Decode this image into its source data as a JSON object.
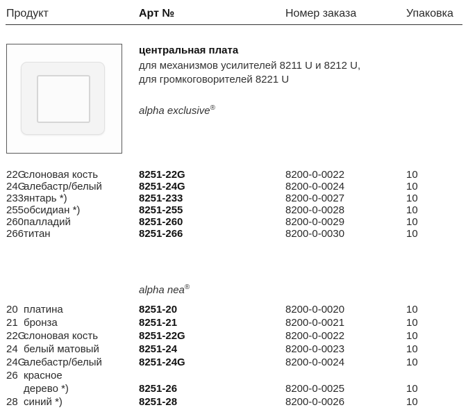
{
  "header": {
    "product": "Продукт",
    "article": "Арт №",
    "order_number": "Номер заказа",
    "packaging": "Упаковка"
  },
  "product": {
    "title": "центральная плата",
    "desc_line1": "для механизмов усилителей 8211 U и 8212 U,",
    "desc_line2": "для громкоговорителей 8221 U"
  },
  "sections": [
    {
      "line": "alpha exclusive",
      "reg": "®",
      "rows": [
        {
          "code": "22G",
          "name": "слоновая кость",
          "art": "8251-22G",
          "order": "8200-0-0022",
          "pack": "10"
        },
        {
          "code": "24G",
          "name": "алебастр/белый",
          "art": "8251-24G",
          "order": "8200-0-0024",
          "pack": "10"
        },
        {
          "code": "233",
          "name": "янтарь *)",
          "art": "8251-233",
          "order": "8200-0-0027",
          "pack": "10"
        },
        {
          "code": "255",
          "name": "обсидиан *)",
          "art": "8251-255",
          "order": "8200-0-0028",
          "pack": "10"
        },
        {
          "code": "260",
          "name": "палладий",
          "art": "8251-260",
          "order": "8200-0-0029",
          "pack": "10"
        },
        {
          "code": "266",
          "name": "титан",
          "art": "8251-266",
          "order": "8200-0-0030",
          "pack": "10"
        }
      ]
    },
    {
      "line": "alpha nea",
      "reg": "®",
      "rows": [
        {
          "code": "20",
          "name": "платина",
          "art": "8251-20",
          "order": "8200-0-0020",
          "pack": "10"
        },
        {
          "code": "21",
          "name": "бронза",
          "art": "8251-21",
          "order": "8200-0-0021",
          "pack": "10"
        },
        {
          "code": "22G",
          "name": "слоновая кость",
          "art": "8251-22G",
          "order": "8200-0-0022",
          "pack": "10"
        },
        {
          "code": "24",
          "name": "белый матовый",
          "art": "8251-24",
          "order": "8200-0-0023",
          "pack": "10"
        },
        {
          "code": "24G",
          "name": "алебастр/белый",
          "art": "8251-24G",
          "order": "8200-0-0024",
          "pack": "10"
        },
        {
          "code": "26",
          "name": "красное",
          "art": "",
          "order": "",
          "pack": ""
        },
        {
          "code": "",
          "name": "дерево *)",
          "art": "8251-26",
          "order": "8200-0-0025",
          "pack": "10"
        },
        {
          "code": "28",
          "name": "синий *)",
          "art": "8251-28",
          "order": "8200-0-0026",
          "pack": "10"
        }
      ]
    }
  ]
}
